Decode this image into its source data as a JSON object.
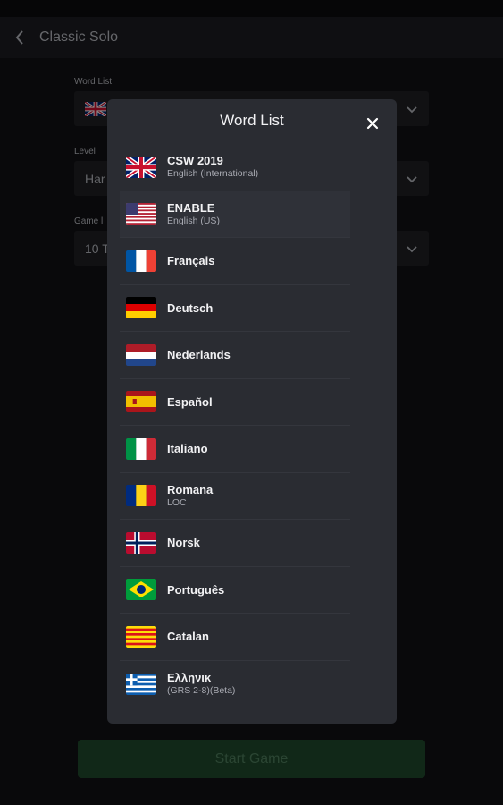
{
  "app_bar": {
    "title": "Classic Solo"
  },
  "form": {
    "word_list_label": "Word List",
    "level_label": "Level",
    "level_value": "Har",
    "game_label": "Game l",
    "game_value": "10 T"
  },
  "start_button": {
    "label": "Start Game"
  },
  "modal": {
    "title": "Word List",
    "items": [
      {
        "name": "CSW 2019",
        "sub": "English (International)",
        "flag": "uk-flag-icon"
      },
      {
        "name": "ENABLE",
        "sub": "English (US)",
        "flag": "us-flag-icon"
      },
      {
        "name": "Français",
        "sub": "",
        "flag": "france-flag-icon"
      },
      {
        "name": "Deutsch",
        "sub": "",
        "flag": "germany-flag-icon"
      },
      {
        "name": "Nederlands",
        "sub": "",
        "flag": "netherlands-flag-icon"
      },
      {
        "name": "Español",
        "sub": "",
        "flag": "spain-flag-icon"
      },
      {
        "name": "Italiano",
        "sub": "",
        "flag": "italy-flag-icon"
      },
      {
        "name": "Romana",
        "sub": "LOC",
        "flag": "romania-flag-icon"
      },
      {
        "name": "Norsk",
        "sub": "",
        "flag": "norway-flag-icon"
      },
      {
        "name": "Português",
        "sub": "",
        "flag": "brazil-flag-icon"
      },
      {
        "name": "Catalan",
        "sub": "",
        "flag": "catalonia-flag-icon"
      },
      {
        "name": "Ελληνικ",
        "sub": "(GRS 2-8)(Beta)",
        "flag": "greece-flag-icon"
      }
    ]
  },
  "colors": {
    "background": "#111114",
    "modal": "#2a2c32",
    "start_button": "#1f4a2c"
  }
}
